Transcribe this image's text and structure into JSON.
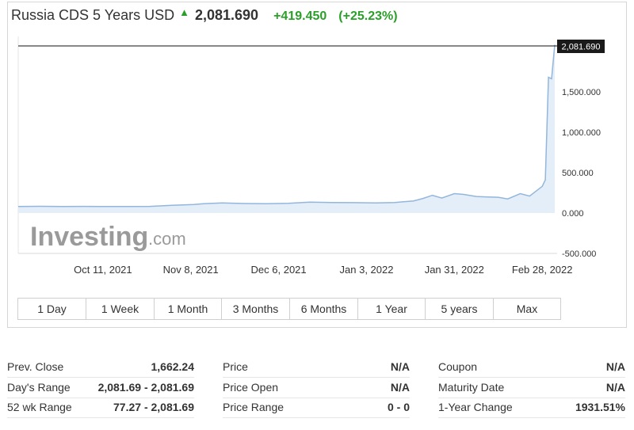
{
  "header": {
    "title": "Russia CDS 5 Years USD",
    "last": "2,081.690",
    "change": "+419.450",
    "change_pct": "(+25.23%)",
    "arrow": "▲"
  },
  "colors": {
    "up": "#2aa02a",
    "line": "#93b6dc",
    "fill": "#e4eef8"
  },
  "chart_data": {
    "type": "area",
    "title": "",
    "xlabel": "",
    "ylabel": "",
    "x_tick_labels": [
      "Oct 11, 2021",
      "Nov 8, 2021",
      "Dec 6, 2021",
      "Jan 3, 2022",
      "Jan 31, 2022",
      "Feb 28, 2022"
    ],
    "y_tick_labels": [
      "1,500.000",
      "1,000.000",
      "500.000",
      "0.000",
      "-500.000"
    ],
    "ylim": [
      -500,
      2150
    ],
    "last_value_label": "2,081.690",
    "grid": false,
    "series": [
      {
        "x": [
          "2021-09-14",
          "2021-09-21",
          "2021-09-28",
          "2021-10-05",
          "2021-10-12",
          "2021-10-19",
          "2021-10-26",
          "2021-11-02",
          "2021-11-09",
          "2021-11-12",
          "2021-11-18",
          "2021-11-25",
          "2021-12-02",
          "2021-12-09",
          "2021-12-16",
          "2021-12-23",
          "2021-12-30",
          "2022-01-06",
          "2022-01-12",
          "2022-01-18",
          "2022-01-21",
          "2022-01-24",
          "2022-01-27",
          "2022-01-31",
          "2022-02-03",
          "2022-02-07",
          "2022-02-10",
          "2022-02-14",
          "2022-02-17",
          "2022-02-21",
          "2022-02-24",
          "2022-02-28",
          "2022-03-01",
          "2022-03-02",
          "2022-03-03",
          "2022-03-04"
        ],
        "values": [
          80,
          83,
          80,
          82,
          80,
          81,
          82,
          95,
          105,
          115,
          125,
          118,
          115,
          120,
          135,
          130,
          128,
          125,
          130,
          150,
          180,
          220,
          185,
          240,
          230,
          205,
          200,
          195,
          175,
          240,
          210,
          330,
          410,
          1680,
          1662,
          2082
        ]
      }
    ]
  },
  "tabs": [
    "1 Day",
    "1 Week",
    "1 Month",
    "3 Months",
    "6 Months",
    "1 Year",
    "5 years",
    "Max"
  ],
  "stats": {
    "col1": [
      {
        "label": "Prev. Close",
        "value": "1,662.24"
      },
      {
        "label": "Day's Range",
        "value": "2,081.69 - 2,081.69"
      },
      {
        "label": "52 wk Range",
        "value": "77.27 - 2,081.69"
      }
    ],
    "col2": [
      {
        "label": "Price",
        "value": "N/A"
      },
      {
        "label": "Price Open",
        "value": "N/A"
      },
      {
        "label": "Price Range",
        "value": "0 - 0"
      }
    ],
    "col3": [
      {
        "label": "Coupon",
        "value": "N/A"
      },
      {
        "label": "Maturity Date",
        "value": "N/A"
      },
      {
        "label": "1-Year Change",
        "value": "1931.51%"
      }
    ]
  }
}
